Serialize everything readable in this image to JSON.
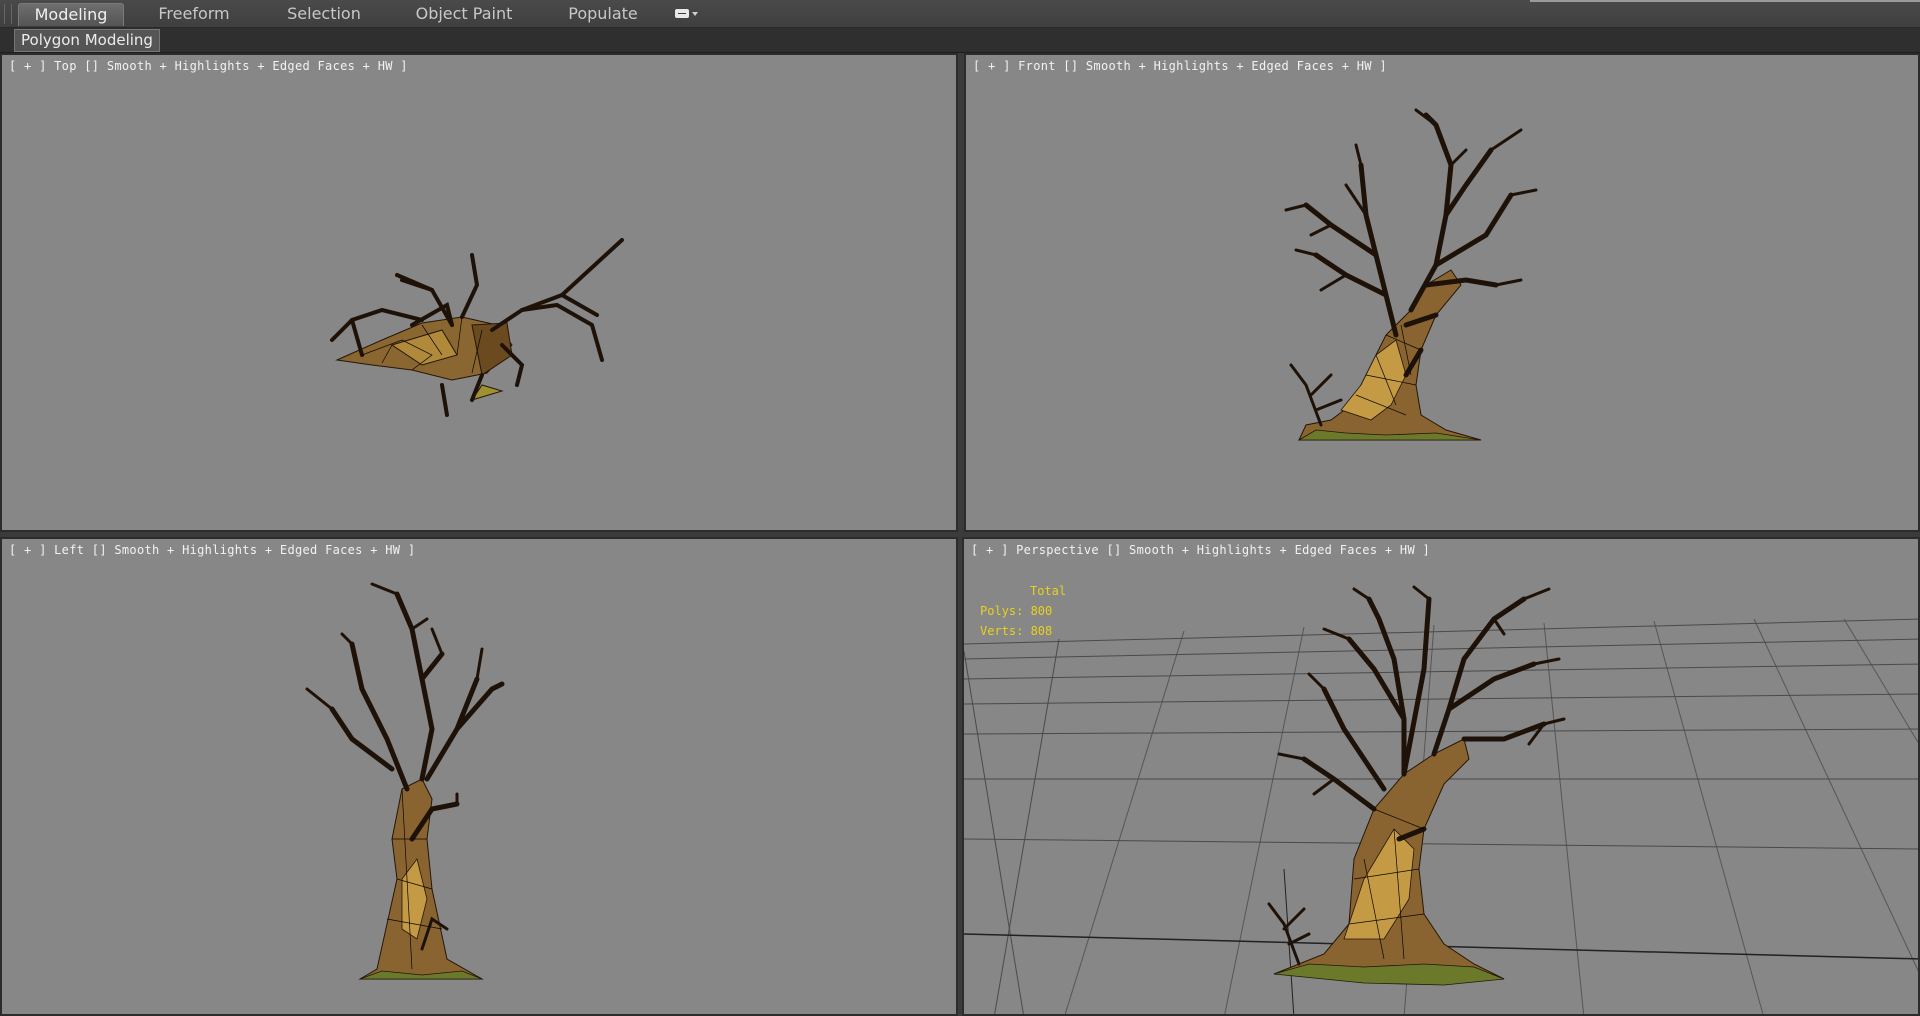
{
  "ribbon": {
    "tabs": [
      {
        "label": "Modeling",
        "active": true
      },
      {
        "label": "Freeform",
        "active": false
      },
      {
        "label": "Selection",
        "active": false
      },
      {
        "label": "Object Paint",
        "active": false
      },
      {
        "label": "Populate",
        "active": false
      }
    ],
    "more_icon": "ribbon-options-icon"
  },
  "panel": {
    "label": "Polygon Modeling"
  },
  "viewports": {
    "top": {
      "plus": "[ + ]",
      "view": "Top",
      "shading": "Smooth + Highlights + Edged Faces + HW ]"
    },
    "front": {
      "plus": "[ + ]",
      "view": "Front",
      "shading": "Smooth + Highlights + Edged Faces + HW ]"
    },
    "left": {
      "plus": "[ + ]",
      "view": "Left",
      "shading": "Smooth + Highlights + Edged Faces + HW ]"
    },
    "perspective": {
      "plus": "[ + ]",
      "view": "Perspective",
      "shading": "Smooth + Highlights + Edged Faces + HW ]"
    }
  },
  "stats": {
    "heading": "Total",
    "polys": "Polys: 800",
    "verts": "Verts: 808"
  },
  "colors": {
    "viewport_bg": "#878787",
    "bark": "#7a5428",
    "bark_edge": "#241608",
    "stats_text": "#e6d21c"
  }
}
